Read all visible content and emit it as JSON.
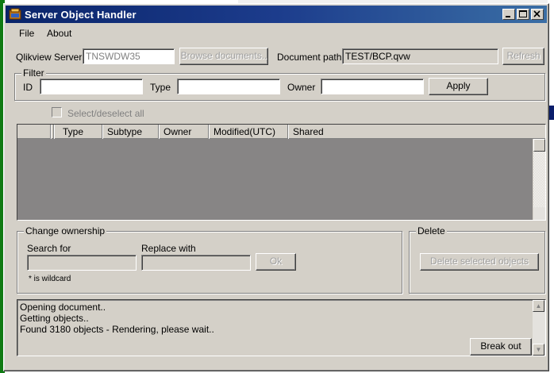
{
  "window": {
    "title": "Server Object Handler"
  },
  "menu": {
    "items": [
      "File",
      "About"
    ]
  },
  "server": {
    "label": "Qlikview Server",
    "value": "TNSWDW35",
    "browse_label": "Browse documents..",
    "doc_path_label": "Document path",
    "doc_path_value": "TEST/BCP.qvw",
    "refresh_label": "Refresh"
  },
  "filter": {
    "caption": "Filter",
    "id_label": "ID",
    "type_label": "Type",
    "owner_label": "Owner",
    "apply_label": "Apply"
  },
  "select_all_label": "Select/deselect all",
  "grid": {
    "columns": [
      "Type",
      "Subtype",
      "Owner",
      "Modified(UTC)",
      "Shared"
    ]
  },
  "change_ownership": {
    "caption": "Change ownership",
    "search_label": "Search for",
    "replace_label": "Replace with",
    "ok_label": "Ok",
    "wildcard_note": "* is wildcard"
  },
  "delete": {
    "caption": "Delete",
    "button_label": "Delete selected objects"
  },
  "log": {
    "lines": [
      "Opening document..",
      "Getting objects..",
      "Found 3180 objects - Rendering, please wait.."
    ],
    "break_label": "Break out"
  },
  "colors": {
    "titlebar_start": "#0a246a",
    "titlebar_end": "#3a6ea5",
    "face": "#d4d0c8",
    "grid_background": "#878585"
  }
}
